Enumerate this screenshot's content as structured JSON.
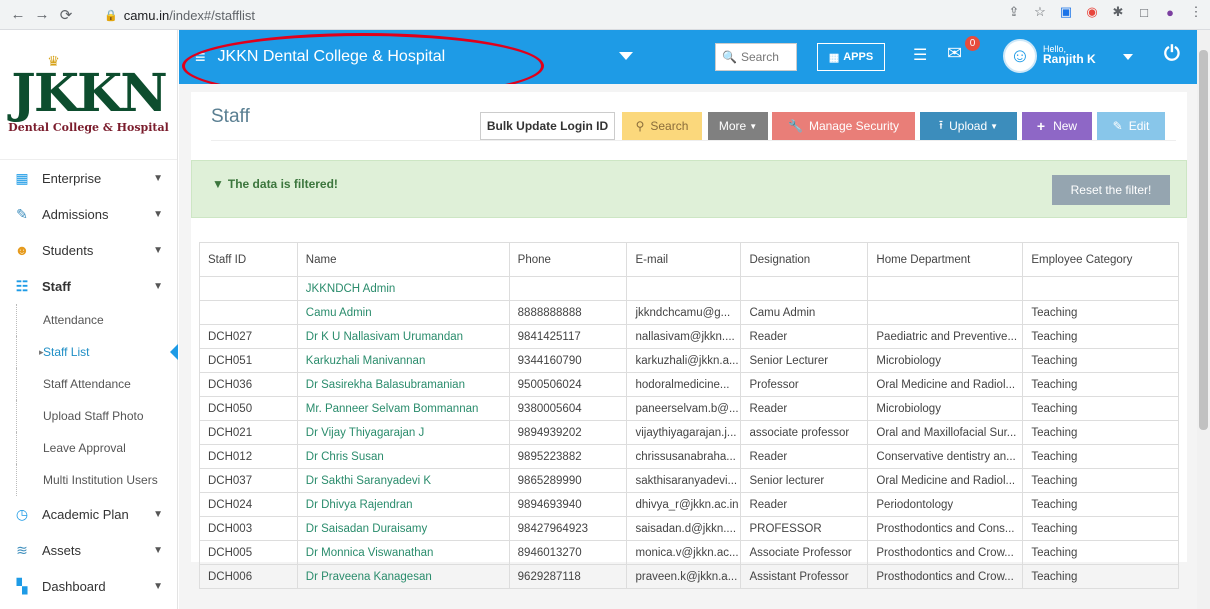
{
  "browser": {
    "url_host": "camu.in",
    "url_path": "/index#/stafflist"
  },
  "header": {
    "institution": "JKKN Dental College & Hospital",
    "search_placeholder": "Search",
    "apps_label": "APPS",
    "mail_badge": "0",
    "hello": "Hello,",
    "user_name": "Ranjith K"
  },
  "logo": {
    "title": "JKKN",
    "subtitle": "Dental College & Hospital"
  },
  "sidebar": {
    "items": [
      {
        "label": "Enterprise",
        "icon": "building-icon"
      },
      {
        "label": "Admissions",
        "icon": "pencil-icon"
      },
      {
        "label": "Students",
        "icon": "students-icon"
      },
      {
        "label": "Staff",
        "icon": "staff-icon"
      }
    ],
    "sub_items": [
      {
        "label": "Attendance"
      },
      {
        "label": "Staff List"
      },
      {
        "label": "Staff Attendance"
      },
      {
        "label": "Upload Staff Photo"
      },
      {
        "label": "Leave Approval"
      },
      {
        "label": "Multi Institution Users"
      }
    ],
    "items_after": [
      {
        "label": "Academic Plan",
        "icon": "clock-icon"
      },
      {
        "label": "Assets",
        "icon": "coins-icon"
      },
      {
        "label": "Dashboard",
        "icon": "dashboard-icon"
      }
    ]
  },
  "page": {
    "title": "Staff",
    "buttons": {
      "bulk": "Bulk Update Login ID",
      "search": "Search",
      "more": "More",
      "security": "Manage Security",
      "upload": "Upload",
      "new": "New",
      "edit": "Edit"
    },
    "alert": "The data is filtered!",
    "reset": "Reset the filter!"
  },
  "table": {
    "headers": [
      "Staff ID",
      "Name",
      "Phone",
      "E-mail",
      "Designation",
      "Home Department",
      "Employee Category"
    ],
    "rows": [
      [
        "",
        "JKKNDCH Admin",
        "",
        "",
        "",
        "",
        ""
      ],
      [
        "",
        "Camu Admin",
        "8888888888",
        "jkkndchcamu@g...",
        "Camu Admin",
        "",
        "Teaching"
      ],
      [
        "DCH027",
        "Dr K U Nallasivam Urumandan",
        "9841425117",
        "nallasivam@jkkn....",
        "Reader",
        "Paediatric and Preventive...",
        "Teaching"
      ],
      [
        "DCH051",
        "Karkuzhali Manivannan",
        "9344160790",
        "karkuzhali@jkkn.a...",
        "Senior Lecturer",
        "Microbiology",
        "Teaching"
      ],
      [
        "DCH036",
        "Dr Sasirekha Balasubramanian",
        "9500506024",
        "hodoralmedicine...",
        "Professor",
        "Oral Medicine and Radiol...",
        "Teaching"
      ],
      [
        "DCH050",
        "Mr. Panneer Selvam Bommannan",
        "9380005604",
        "paneerselvam.b@...",
        "Reader",
        "Microbiology",
        "Teaching"
      ],
      [
        "DCH021",
        "Dr Vijay Thiyagarajan J",
        "9894939202",
        "vijaythiyagarajan.j...",
        "associate professor",
        "Oral and Maxillofacial Sur...",
        "Teaching"
      ],
      [
        "DCH012",
        "Dr Chris Susan",
        "9895223882",
        "chrissusanabraha...",
        "Reader",
        "Conservative dentistry an...",
        "Teaching"
      ],
      [
        "DCH037",
        "Dr Sakthi Saranyadevi K",
        "9865289990",
        "sakthisaranyadevi...",
        "Senior lecturer",
        "Oral Medicine and Radiol...",
        "Teaching"
      ],
      [
        "DCH024",
        "Dr Dhivya Rajendran",
        "9894693940",
        "dhivya_r@jkkn.ac.in",
        "Reader",
        "Periodontology",
        "Teaching"
      ],
      [
        "DCH003",
        "Dr Saisadan Duraisamy",
        "98427964923",
        "saisadan.d@jkkn....",
        "PROFESSOR",
        "Prosthodontics and Cons...",
        "Teaching"
      ],
      [
        "DCH005",
        "Dr Monnica Viswanathan",
        "8946013270",
        "monica.v@jkkn.ac...",
        "Associate Professor",
        "Prosthodontics and Crow...",
        "Teaching"
      ],
      [
        "DCH006",
        "Dr Praveena Kanagesan",
        "9629287118",
        "praveen.k@jkkn.a...",
        "Assistant Professor",
        "Prosthodontics and Crow...",
        "Teaching"
      ]
    ]
  }
}
